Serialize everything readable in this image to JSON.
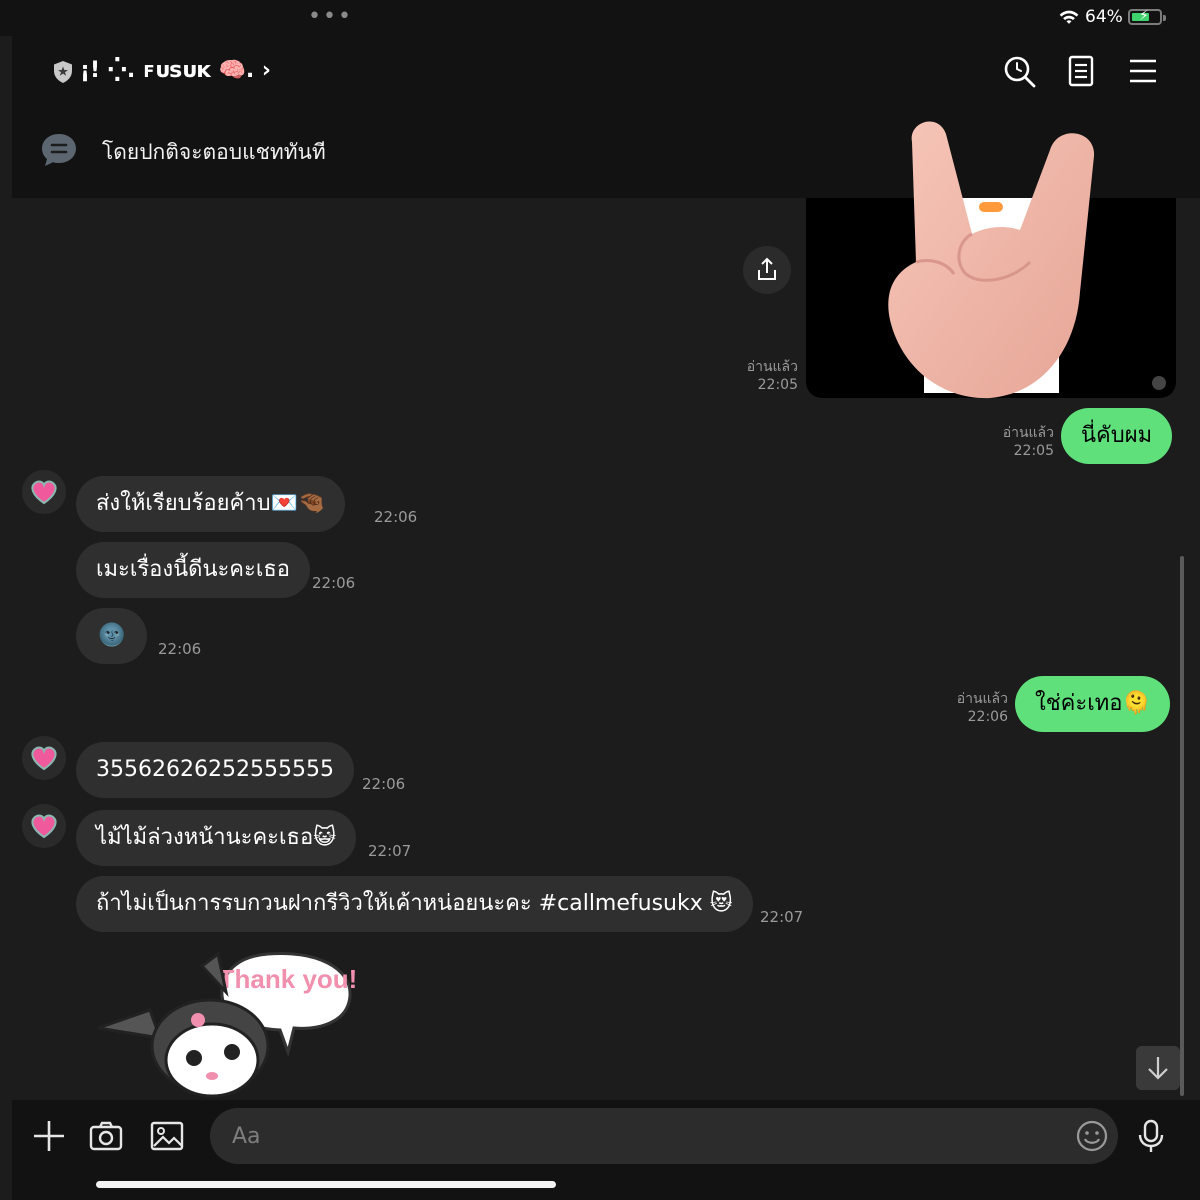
{
  "status_bar": {
    "dots": "•••",
    "battery_percent": "64%",
    "battery_level": 0.64,
    "charging": true
  },
  "header": {
    "title": "¡! ⁛. ꜰᴜꜱᴜᴋ 🧠. ›",
    "icons": [
      "search-icon",
      "notes-icon",
      "menu-icon"
    ],
    "notice": "โดยปกติจะตอบแชททันที"
  },
  "messages": [
    {
      "type": "image",
      "direction": "out",
      "read": "อ่านแล้ว",
      "time": "22:05"
    },
    {
      "type": "text",
      "direction": "out",
      "read": "อ่านแล้ว",
      "time": "22:05",
      "text": "นี่คับผม"
    },
    {
      "type": "text",
      "direction": "in",
      "time": "22:06",
      "text": "ส่งให้เรียบร้อยค้าบ💌🤏🏾"
    },
    {
      "type": "text",
      "direction": "in",
      "time": "22:06",
      "text": "เมะเรื่องนี้ดีนะคะเธอ"
    },
    {
      "type": "text",
      "direction": "in",
      "time": "22:06",
      "text": "🌚"
    },
    {
      "type": "text",
      "direction": "out",
      "read": "อ่านแล้ว",
      "time": "22:06",
      "text": "ใช่ค่ะเทอ🫠"
    },
    {
      "type": "text",
      "direction": "in",
      "time": "22:06",
      "text": "35562626252555555"
    },
    {
      "type": "text",
      "direction": "in",
      "time": "22:07",
      "text": "ไม้ไม้ล่วงหน้านะคะเธอ😺"
    },
    {
      "type": "text",
      "direction": "in",
      "time": "22:07",
      "text": "ถ้าไม่เป็นการรบกวนฝากรีวิวให้เค้าหน่อยนะคะ #callmefusukx 😻"
    },
    {
      "type": "sticker",
      "direction": "in",
      "text": "Thank you!"
    }
  ],
  "input": {
    "placeholder": "Aa",
    "value": ""
  },
  "colors": {
    "outgoing_bubble": "#5fe07a",
    "incoming_bubble": "#2f2f2f",
    "background": "#1c1c1c",
    "header": "#121212"
  }
}
